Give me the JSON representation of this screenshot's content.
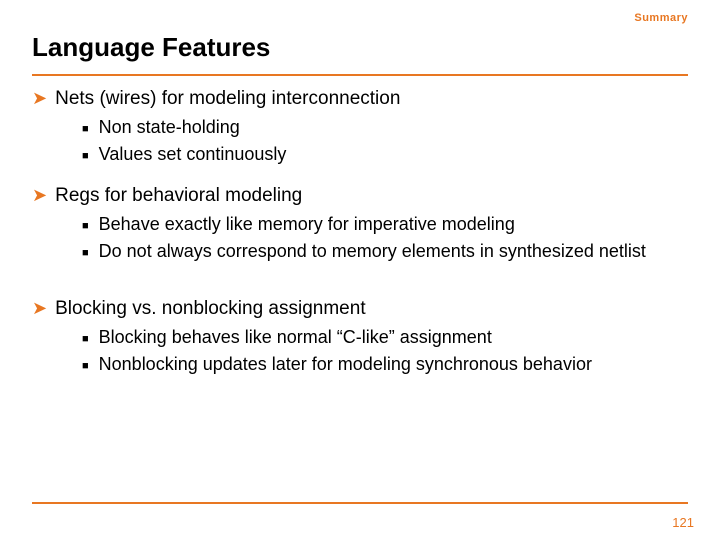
{
  "header_label": "Summary",
  "title": "Language Features",
  "bullets": {
    "b1": "Nets (wires) for modeling interconnection",
    "b1_1": "Non state-holding",
    "b1_2": "Values set continuously",
    "b2": "Regs for behavioral modeling",
    "b2_1": "Behave exactly like memory for imperative modeling",
    "b2_2": "Do not always correspond to memory elements in synthesized netlist",
    "b3": "Blocking vs. nonblocking assignment",
    "b3_1": "Blocking behaves like normal “C-like” assignment",
    "b3_2": "Nonblocking updates later for modeling synchronous behavior"
  },
  "page_number": "121"
}
